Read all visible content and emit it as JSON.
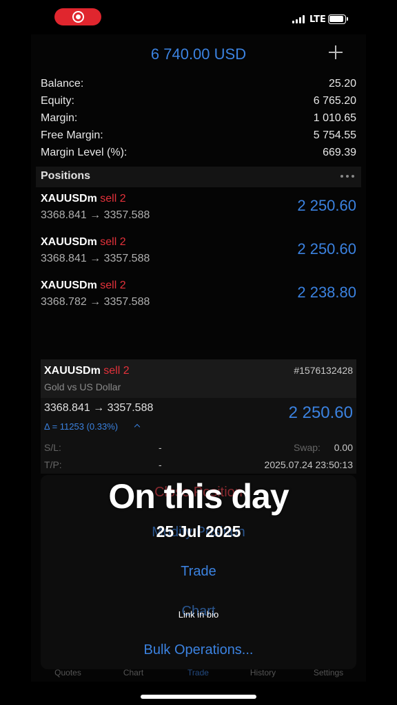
{
  "status": {
    "network": "LTE"
  },
  "header": {
    "equity_title": "6 740.00 USD"
  },
  "account": [
    {
      "label": "Balance:",
      "value": "25.20"
    },
    {
      "label": "Equity:",
      "value": "6 765.20"
    },
    {
      "label": "Margin:",
      "value": "1 010.65"
    },
    {
      "label": "Free Margin:",
      "value": "5 754.55"
    },
    {
      "label": "Margin Level (%):",
      "value": "669.39"
    }
  ],
  "positions_header": "Positions",
  "positions": [
    {
      "symbol": "XAUUSDm",
      "side": "sell 2",
      "prices": "3368.841 → 3357.588",
      "profit": "2 250.60"
    },
    {
      "symbol": "XAUUSDm",
      "side": "sell 2",
      "prices": "3368.841 → 3357.588",
      "profit": "2 250.60"
    },
    {
      "symbol": "XAUUSDm",
      "side": "sell 2",
      "prices": "3368.782 → 3357.588",
      "profit": "2 238.80"
    }
  ],
  "detail": {
    "symbol": "XAUUSDm",
    "side": "sell 2",
    "ticket": "#1576132428",
    "description": "Gold vs US Dollar",
    "prices": "3368.841 → 3357.588",
    "profit": "2 250.60",
    "delta": "Δ = 11253 (0.33%)",
    "sl_label": "S/L:",
    "sl_value": "-",
    "swap_label": "Swap:",
    "swap_value": "0.00",
    "tp_label": "T/P:",
    "tp_value": "-",
    "open_time": "2025.07.24 23:50:13"
  },
  "actions": {
    "close": "Close Position",
    "modify": "Modify Position",
    "trade": "Trade",
    "chart": "Chart",
    "bulk": "Bulk Operations..."
  },
  "tabs": [
    "Quotes",
    "Chart",
    "Trade",
    "History",
    "Settings"
  ],
  "overlay": {
    "title": "On this day",
    "date": "25 Jul 2025",
    "link": "Link in bio"
  },
  "colors": {
    "profit_blue": "#3b82e0",
    "sell_red": "#e5323b",
    "record_red": "#e0262e"
  }
}
